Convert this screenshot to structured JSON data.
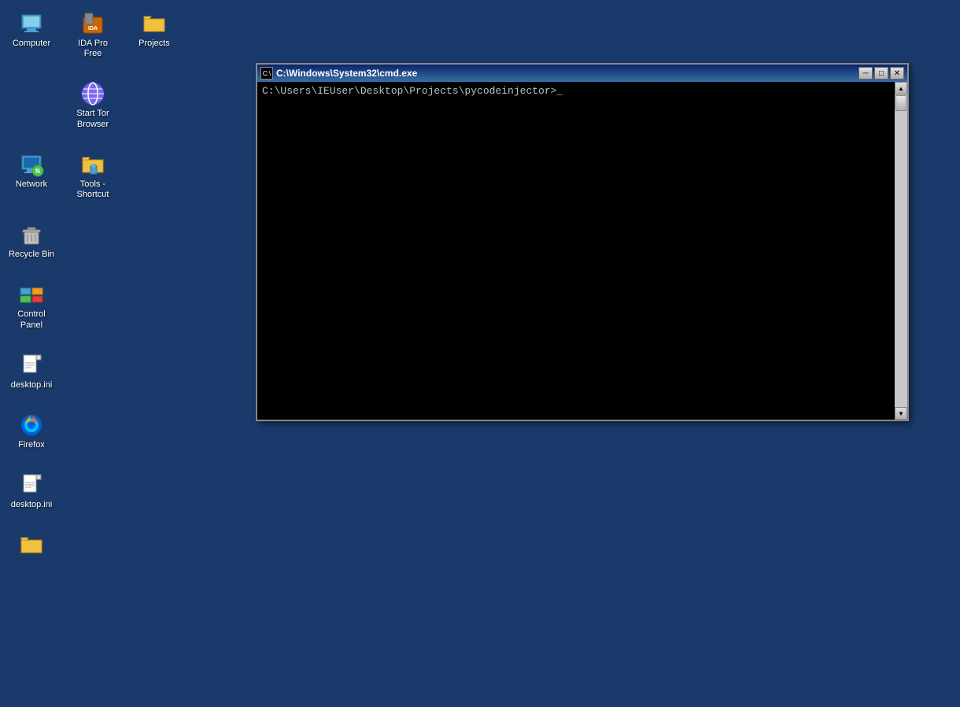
{
  "desktop": {
    "background_color": "#1a3a6b"
  },
  "icons": [
    {
      "id": "computer",
      "label": "Computer",
      "type": "computer"
    },
    {
      "id": "ida-pro-free",
      "label": "IDA Pro Free",
      "type": "ida"
    },
    {
      "id": "projects",
      "label": "Projects",
      "type": "folder"
    },
    {
      "id": "start-tor-browser",
      "label": "Start Tor Browser",
      "type": "tor"
    },
    {
      "id": "network",
      "label": "Network",
      "type": "network"
    },
    {
      "id": "tools-shortcut",
      "label": "Tools - Shortcut",
      "type": "tools"
    },
    {
      "id": "recycle-bin",
      "label": "Recycle Bin",
      "type": "recycle"
    },
    {
      "id": "control-panel",
      "label": "Control Panel",
      "type": "controlpanel"
    },
    {
      "id": "desktop-ini-1",
      "label": "desktop.ini",
      "type": "ini"
    },
    {
      "id": "firefox",
      "label": "Firefox",
      "type": "firefox"
    },
    {
      "id": "desktop-ini-2",
      "label": "desktop.ini",
      "type": "ini"
    },
    {
      "id": "folder-bottom",
      "label": "",
      "type": "folder-yellow"
    }
  ],
  "cmd_window": {
    "title": "C:\\Windows\\System32\\cmd.exe",
    "title_icon": "cmd",
    "minimize_label": "─",
    "maximize_label": "□",
    "close_label": "✕",
    "prompt_text": "C:\\Users\\IEUser\\Desktop\\Projects\\pycodeinjector>_"
  }
}
